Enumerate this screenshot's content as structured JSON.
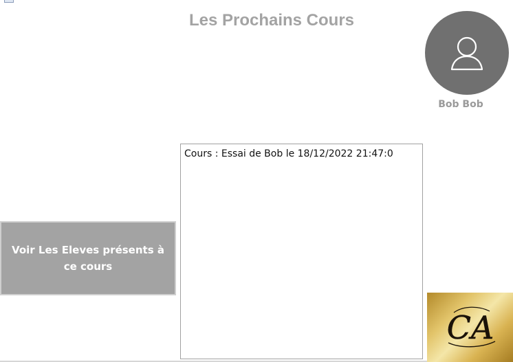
{
  "header": {
    "title": "Les Prochains Cours"
  },
  "user": {
    "name": "Bob Bob",
    "avatar_icon": "user-icon",
    "avatar_color": "#707070"
  },
  "courses": {
    "items": [
      {
        "label": "Cours : Essai de Bob le 18/12/2022 21:47:0"
      }
    ]
  },
  "actions": {
    "view_students_label": "Voir Les Eleves présents à ce cours"
  },
  "logo": {
    "monogram": "CA",
    "icon": "ca-monogram-logo"
  }
}
